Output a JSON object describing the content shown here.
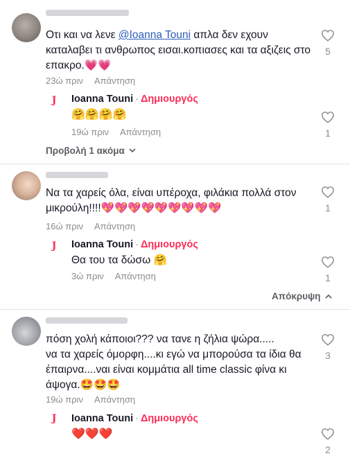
{
  "comments": [
    {
      "text_pre": "Οτι και να λενε ",
      "mention": "@Ioanna Touni",
      "text_post": " απλα δεν εχουν καταλαβει τι ανθρωπος εισαι.κοπιασες και τα αξιζεις στο επακρο.",
      "emojis": "💗💗",
      "time": "23ώ πριν",
      "reply_label": "Απάντηση",
      "likes": "5",
      "reply": {
        "name": "Ioanna Touni",
        "creator": "Δημιουργός",
        "emojis": "🤗🤗🤗🤗",
        "time": "19ώ πριν",
        "reply_label": "Απάντηση",
        "likes": "1"
      },
      "more": "Προβολή 1 ακόμα"
    },
    {
      "text": "Να τα χαρείς όλα, είναι υπέροχα, φιλάκια πολλά στον μικρούλη!!!!",
      "emojis": "💖💖💖💖💖💖💖💖💖",
      "time": "16ώ πριν",
      "reply_label": "Απάντηση",
      "likes": "1",
      "reply": {
        "name": "Ioanna Touni",
        "creator": "Δημιουργός",
        "text": "Θα του τα δώσω ",
        "emojis": "🤗",
        "time": "3ώ πριν",
        "reply_label": "Απάντηση",
        "likes": "1"
      },
      "hide": "Απόκρυψη"
    },
    {
      "line1": "πόση χολή κάποιοι??? να τανε η ζήλια ψώρα.....",
      "line2": "να τα χαρείς όμορφη....κι εγώ να μπορούσα τα ίδια θα",
      "line3": "έπαιρνα....ναι είναι κομμάτια all time classic φίνα κι",
      "line4": "άψογα.",
      "emojis": "🤩🤩🤩",
      "time": "19ώ πριν",
      "reply_label": "Απάντηση",
      "likes": "3",
      "reply": {
        "name": "Ioanna Touni",
        "creator": "Δημιουργός",
        "emojis": "❤️❤️❤️",
        "likes": "2"
      }
    }
  ],
  "colors": {
    "creator": "#fe2c55",
    "muted": "#8a8b91",
    "mention": "#2b5db9"
  },
  "icons": [
    "heart-outline-icon",
    "chevron-down-icon",
    "chevron-up-icon",
    "tiktok-logo-icon"
  ]
}
